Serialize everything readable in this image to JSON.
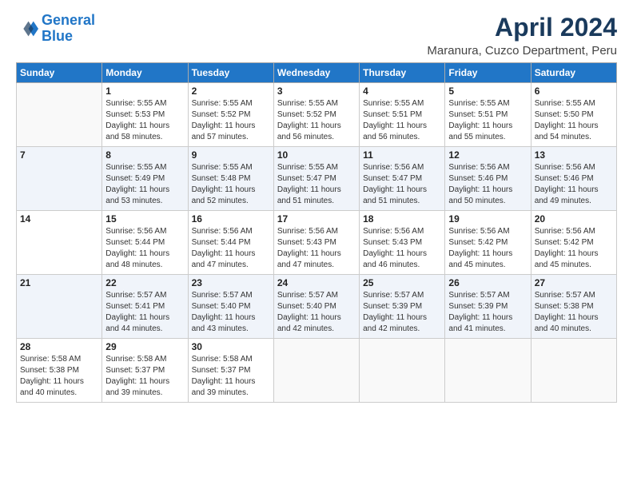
{
  "logo": {
    "line1": "General",
    "line2": "Blue"
  },
  "title": "April 2024",
  "subtitle": "Maranura, Cuzco Department, Peru",
  "days_header": [
    "Sunday",
    "Monday",
    "Tuesday",
    "Wednesday",
    "Thursday",
    "Friday",
    "Saturday"
  ],
  "weeks": [
    [
      {
        "day": "",
        "info": ""
      },
      {
        "day": "1",
        "info": "Sunrise: 5:55 AM\nSunset: 5:53 PM\nDaylight: 11 hours\nand 58 minutes."
      },
      {
        "day": "2",
        "info": "Sunrise: 5:55 AM\nSunset: 5:52 PM\nDaylight: 11 hours\nand 57 minutes."
      },
      {
        "day": "3",
        "info": "Sunrise: 5:55 AM\nSunset: 5:52 PM\nDaylight: 11 hours\nand 56 minutes."
      },
      {
        "day": "4",
        "info": "Sunrise: 5:55 AM\nSunset: 5:51 PM\nDaylight: 11 hours\nand 56 minutes."
      },
      {
        "day": "5",
        "info": "Sunrise: 5:55 AM\nSunset: 5:51 PM\nDaylight: 11 hours\nand 55 minutes."
      },
      {
        "day": "6",
        "info": "Sunrise: 5:55 AM\nSunset: 5:50 PM\nDaylight: 11 hours\nand 54 minutes."
      }
    ],
    [
      {
        "day": "7",
        "info": ""
      },
      {
        "day": "8",
        "info": "Sunrise: 5:55 AM\nSunset: 5:49 PM\nDaylight: 11 hours\nand 53 minutes."
      },
      {
        "day": "9",
        "info": "Sunrise: 5:55 AM\nSunset: 5:48 PM\nDaylight: 11 hours\nand 52 minutes."
      },
      {
        "day": "10",
        "info": "Sunrise: 5:55 AM\nSunset: 5:47 PM\nDaylight: 11 hours\nand 51 minutes."
      },
      {
        "day": "11",
        "info": "Sunrise: 5:56 AM\nSunset: 5:47 PM\nDaylight: 11 hours\nand 51 minutes."
      },
      {
        "day": "12",
        "info": "Sunrise: 5:56 AM\nSunset: 5:46 PM\nDaylight: 11 hours\nand 50 minutes."
      },
      {
        "day": "13",
        "info": "Sunrise: 5:56 AM\nSunset: 5:46 PM\nDaylight: 11 hours\nand 49 minutes."
      }
    ],
    [
      {
        "day": "14",
        "info": ""
      },
      {
        "day": "15",
        "info": "Sunrise: 5:56 AM\nSunset: 5:44 PM\nDaylight: 11 hours\nand 48 minutes."
      },
      {
        "day": "16",
        "info": "Sunrise: 5:56 AM\nSunset: 5:44 PM\nDaylight: 11 hours\nand 47 minutes."
      },
      {
        "day": "17",
        "info": "Sunrise: 5:56 AM\nSunset: 5:43 PM\nDaylight: 11 hours\nand 47 minutes."
      },
      {
        "day": "18",
        "info": "Sunrise: 5:56 AM\nSunset: 5:43 PM\nDaylight: 11 hours\nand 46 minutes."
      },
      {
        "day": "19",
        "info": "Sunrise: 5:56 AM\nSunset: 5:42 PM\nDaylight: 11 hours\nand 45 minutes."
      },
      {
        "day": "20",
        "info": "Sunrise: 5:56 AM\nSunset: 5:42 PM\nDaylight: 11 hours\nand 45 minutes."
      }
    ],
    [
      {
        "day": "21",
        "info": ""
      },
      {
        "day": "22",
        "info": "Sunrise: 5:57 AM\nSunset: 5:41 PM\nDaylight: 11 hours\nand 44 minutes."
      },
      {
        "day": "23",
        "info": "Sunrise: 5:57 AM\nSunset: 5:40 PM\nDaylight: 11 hours\nand 43 minutes."
      },
      {
        "day": "24",
        "info": "Sunrise: 5:57 AM\nSunset: 5:40 PM\nDaylight: 11 hours\nand 42 minutes."
      },
      {
        "day": "25",
        "info": "Sunrise: 5:57 AM\nSunset: 5:39 PM\nDaylight: 11 hours\nand 42 minutes."
      },
      {
        "day": "26",
        "info": "Sunrise: 5:57 AM\nSunset: 5:39 PM\nDaylight: 11 hours\nand 41 minutes."
      },
      {
        "day": "27",
        "info": "Sunrise: 5:57 AM\nSunset: 5:38 PM\nDaylight: 11 hours\nand 40 minutes."
      }
    ],
    [
      {
        "day": "28",
        "info": "Sunrise: 5:58 AM\nSunset: 5:38 PM\nDaylight: 11 hours\nand 40 minutes."
      },
      {
        "day": "29",
        "info": "Sunrise: 5:58 AM\nSunset: 5:37 PM\nDaylight: 11 hours\nand 39 minutes."
      },
      {
        "day": "30",
        "info": "Sunrise: 5:58 AM\nSunset: 5:37 PM\nDaylight: 11 hours\nand 39 minutes."
      },
      {
        "day": "",
        "info": ""
      },
      {
        "day": "",
        "info": ""
      },
      {
        "day": "",
        "info": ""
      },
      {
        "day": "",
        "info": ""
      }
    ]
  ]
}
